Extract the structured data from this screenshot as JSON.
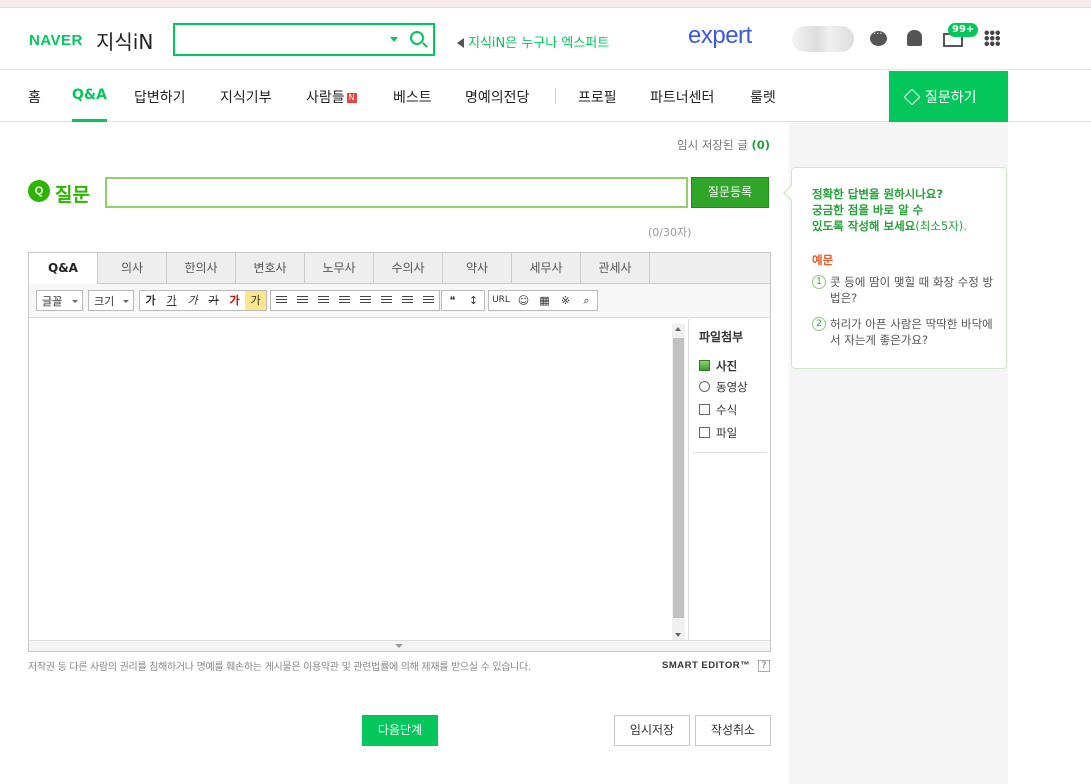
{
  "header": {
    "logo_naver": "NAVER",
    "logo_kin": "지식iN",
    "search_placeholder": "",
    "notice": "지식iN은 누구나 엑스퍼트",
    "expert": "expert",
    "mail_badge": "99+"
  },
  "nav": {
    "items": [
      "홈",
      "Q&A",
      "답변하기",
      "지식기부",
      "사람들",
      "베스트",
      "명예의전당",
      "프로필",
      "파트너센터",
      "룰렛"
    ],
    "new_badge": "N",
    "ask_button": "질문하기"
  },
  "question": {
    "temp_saved_label": "임시 저장된 글",
    "temp_saved_count": "(0)",
    "q_icon": "Q",
    "label": "질문",
    "title_value": "",
    "submit": "질문등록",
    "char_count": "(0/30자)"
  },
  "editor": {
    "tabs": [
      "Q&A",
      "의사",
      "한의사",
      "변호사",
      "노무사",
      "수의사",
      "약사",
      "세무사",
      "관세사"
    ],
    "font_select": "글꼴",
    "size_select": "크기",
    "fmt_bold": "가",
    "fmt_underline": "가",
    "fmt_italic": "가",
    "fmt_strike": "가",
    "fmt_color": "가",
    "fmt_highlight": "가",
    "quote": "❝",
    "url": "URL",
    "emoji": "☺",
    "special": "※",
    "attach_title": "파일첨부",
    "attach_items": [
      "사진",
      "동영상",
      "수식",
      "파일"
    ]
  },
  "footer": {
    "copyright": "저작권 등 다른 사람의 권리를 침해하거나 명예를 훼손하는 게시물은 이용약관 및 관련법률에 의해 제재를 받으실 수 있습니다.",
    "smart_editor": "SMART EDITOR™",
    "help": "?",
    "next": "다음단계",
    "temp_save": "임시저장",
    "cancel": "작성취소"
  },
  "tip": {
    "line1": "정확한 답변을 원하시나요?",
    "line2": "궁금한 점을 바로 알 수",
    "line3": "있도록 작성해 보세요",
    "line3_small": "(최소5자).",
    "example_label": "예문",
    "ex1_num": "1",
    "ex1": "콧 등에 땀이 맺힐 때 화장 수정 방법은?",
    "ex2_num": "2",
    "ex2": "허리가 아픈 사람은 딱딱한 바닥에서 자는게 좋은가요?"
  },
  "colors": {
    "brand_green": "#03c75a",
    "expert_blue": "#3b5bdb",
    "question_green": "#2db400"
  }
}
